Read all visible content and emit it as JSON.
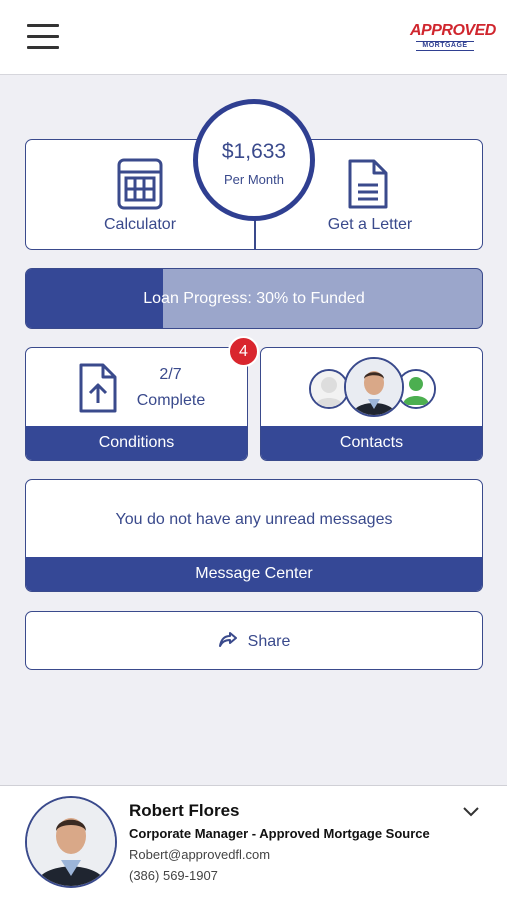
{
  "header": {
    "logo_word": "APPROVED",
    "logo_sub": "MORTGAGE"
  },
  "payment": {
    "amount": "$1,633",
    "period": "Per Month"
  },
  "tiles": {
    "calculator_label": "Calculator",
    "letter_label": "Get a Letter"
  },
  "progress": {
    "text": "Loan Progress: 30% to Funded",
    "fraction": 0.3
  },
  "conditions": {
    "count": "2/7",
    "status": "Complete",
    "label": "Conditions",
    "badge": "4"
  },
  "contacts": {
    "label": "Contacts"
  },
  "messages": {
    "text": "You do not have any unread messages",
    "label": "Message Center"
  },
  "share": {
    "label": "Share"
  },
  "officer": {
    "name": "Robert Flores",
    "title": "Corporate Manager - Approved Mortgage Source",
    "email": "Robert@approvedfl.com",
    "phone": "(386) 569-1907"
  },
  "colors": {
    "primary": "#354896",
    "accent_red": "#d9262e",
    "background": "#efeff4"
  }
}
